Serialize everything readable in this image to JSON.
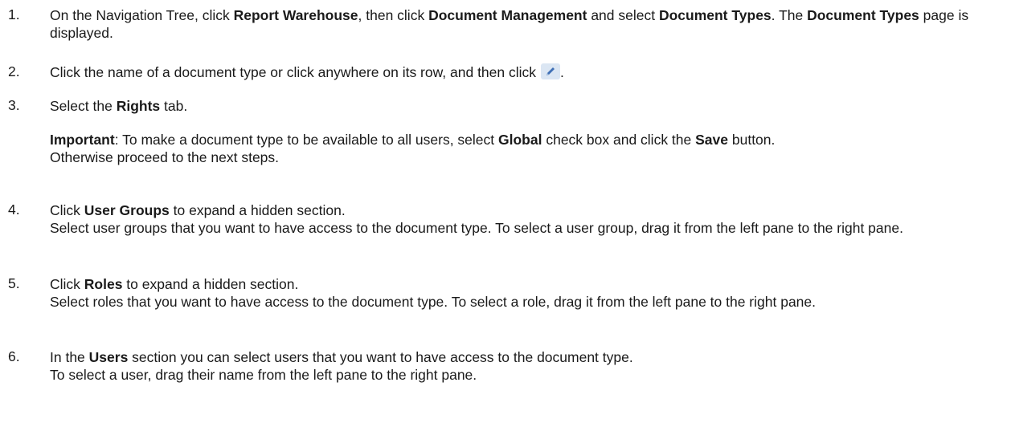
{
  "steps": [
    {
      "num": "1.",
      "parts": [
        {
          "t": "On the Navigation Tree, click ",
          "b": false
        },
        {
          "t": "Report Warehouse",
          "b": true
        },
        {
          "t": ", then click ",
          "b": false
        },
        {
          "t": "Document Management",
          "b": true
        },
        {
          "t": " and select ",
          "b": false
        },
        {
          "t": "Document Types",
          "b": true
        },
        {
          "t": ". The ",
          "b": false
        },
        {
          "t": "Document Types",
          "b": true
        },
        {
          "t": " page is displayed.",
          "b": false
        }
      ]
    },
    {
      "num": "2.",
      "text_before_icon": "Click the name of a document type or click anywhere on its row, and then click",
      "icon": "edit-pencil-icon",
      "text_after_icon": "."
    },
    {
      "num": "3.",
      "parts": [
        {
          "t": "Select the ",
          "b": false
        },
        {
          "t": "Rights",
          "b": true
        },
        {
          "t": " tab.",
          "b": false
        }
      ],
      "note_parts": [
        {
          "t": "Important",
          "b": true
        },
        {
          "t": ": To make a document type to be available to all users, select ",
          "b": false
        },
        {
          "t": "Global",
          "b": true
        },
        {
          "t": " check box and click the ",
          "b": false
        },
        {
          "t": "Save",
          "b": true
        },
        {
          "t": " button.",
          "b": false
        }
      ],
      "note_line2": "Otherwise proceed to the next steps."
    },
    {
      "num": "4.",
      "parts": [
        {
          "t": "Click ",
          "b": false
        },
        {
          "t": "User Groups",
          "b": true
        },
        {
          "t": " to expand a hidden section.",
          "b": false
        }
      ],
      "line2": "Select user groups that you want to have access to the document type. To select a user group, drag it from the left pane to the right pane."
    },
    {
      "num": "5.",
      "parts": [
        {
          "t": "Click ",
          "b": false
        },
        {
          "t": "Roles",
          "b": true
        },
        {
          "t": " to expand a hidden section.",
          "b": false
        }
      ],
      "line2": "Select roles that you want to have access to the document type. To select a role, drag it from the left pane to the right pane."
    },
    {
      "num": "6.",
      "parts": [
        {
          "t": "In the ",
          "b": false
        },
        {
          "t": "Users",
          "b": true
        },
        {
          "t": " section you can select users that you want to have access to the document type.",
          "b": false
        }
      ],
      "line2": "To select a user, drag their name from the left pane to the right pane."
    }
  ]
}
